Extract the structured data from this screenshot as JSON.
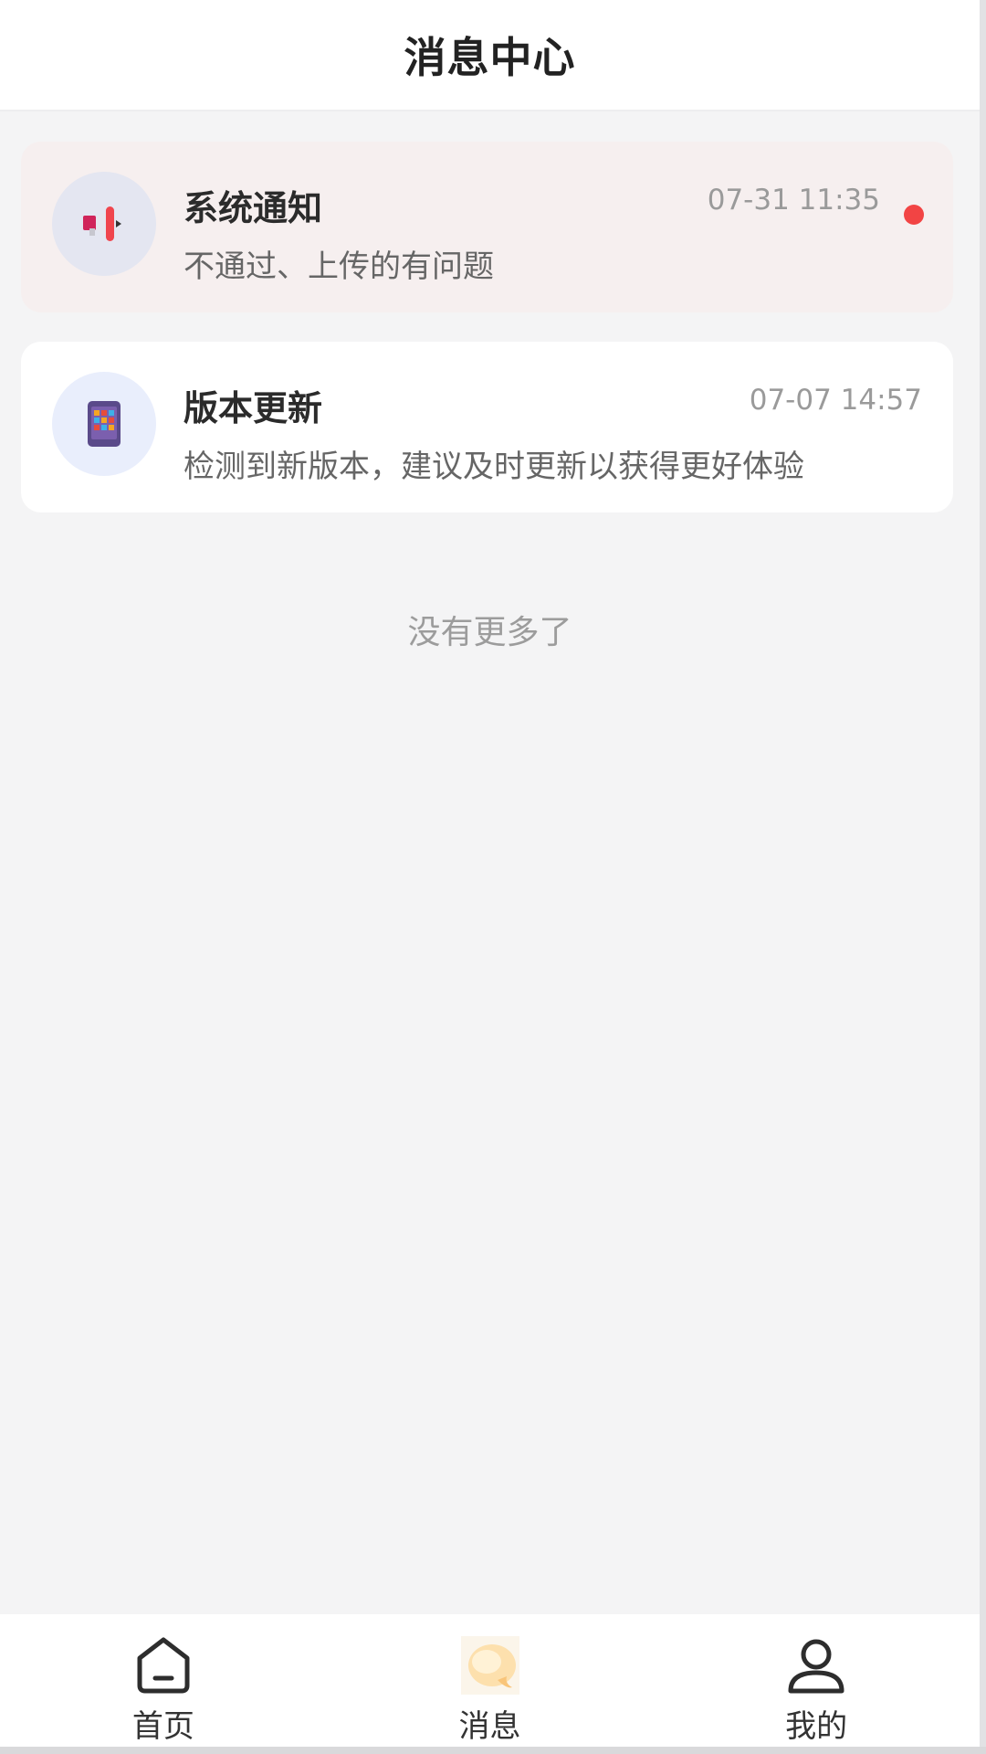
{
  "header": {
    "title": "消息中心"
  },
  "messages": [
    {
      "icon": "megaphone-icon",
      "title": "系统通知",
      "time": "07-31 11:35",
      "desc": "不通过、上传的有问题",
      "unread": true
    },
    {
      "icon": "app-update-icon",
      "title": "版本更新",
      "time": "07-07 14:57",
      "desc": "检测到新版本，建议及时更新以获得更好体验",
      "unread": false
    }
  ],
  "list_end_text": "没有更多了",
  "tabbar": {
    "items": [
      {
        "label": "首页",
        "icon": "home-icon"
      },
      {
        "label": "消息",
        "icon": "message-icon",
        "active": true
      },
      {
        "label": "我的",
        "icon": "user-icon"
      }
    ]
  },
  "colors": {
    "unread_dot": "#f24444",
    "unread_card_bg": "#f6efef",
    "page_bg": "#f4f4f5"
  }
}
